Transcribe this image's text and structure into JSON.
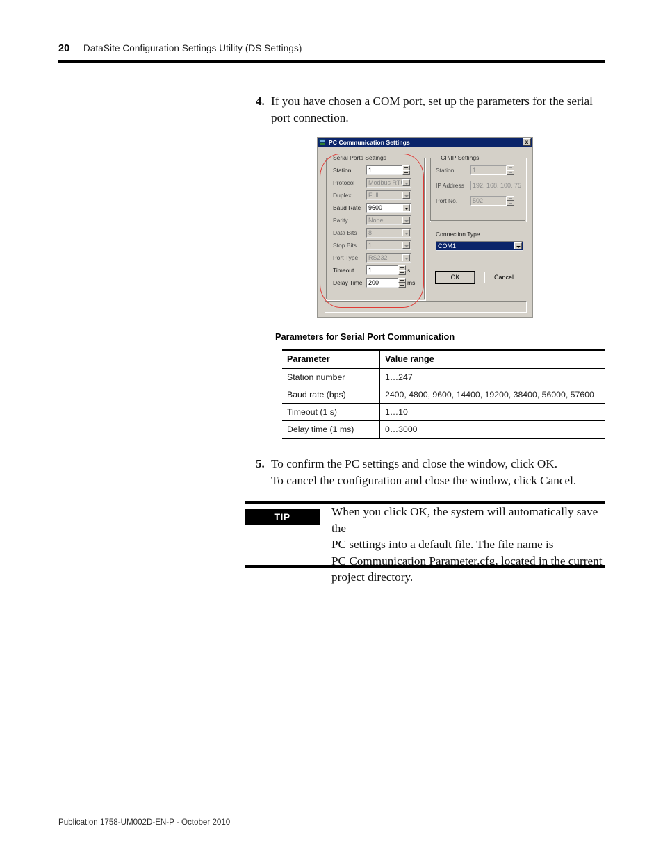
{
  "header": {
    "page_number": "20",
    "title": "DataSite Configuration Settings Utility (DS Settings)"
  },
  "steps": {
    "step4": {
      "number": "4.",
      "text": "If you have chosen a COM port, set up the parameters for the serial port connection."
    },
    "step5": {
      "number": "5.",
      "line1": "To confirm the PC settings and close the window, click OK.",
      "line2": "To cancel the configuration and close the window, click Cancel."
    }
  },
  "dialog": {
    "title": "PC Communication Settings",
    "close_label": "x",
    "serial_group_label": "Serial Ports Settings",
    "tcp_group_label": "TCP/IP Settings",
    "serial_fields": [
      {
        "label": "Station",
        "value": "1",
        "unit": ""
      },
      {
        "label": "Protocol",
        "value": "Modbus RTU",
        "unit": ""
      },
      {
        "label": "Duplex",
        "value": "Full",
        "unit": ""
      },
      {
        "label": "Baud Rate",
        "value": "9600",
        "unit": ""
      },
      {
        "label": "Parity",
        "value": "None",
        "unit": ""
      },
      {
        "label": "Data Bits",
        "value": "8",
        "unit": ""
      },
      {
        "label": "Stop Bits",
        "value": "1",
        "unit": ""
      },
      {
        "label": "Port Type",
        "value": "RS232",
        "unit": ""
      },
      {
        "label": "Timeout",
        "value": "1",
        "unit": "s"
      },
      {
        "label": "Delay Time",
        "value": "200",
        "unit": "ms"
      }
    ],
    "tcp_fields": [
      {
        "label": "Station",
        "value": "1"
      },
      {
        "label": "IP Address",
        "value": "192. 168. 100.  75"
      },
      {
        "label": "Port No.",
        "value": "502"
      }
    ],
    "connection_type_label": "Connection Type",
    "connection_type_value": "COM1",
    "ok_label": "OK",
    "cancel_label": "Cancel",
    "accent_selection_color": "#0a246a",
    "annotation_color": "#e03a36",
    "chrome_color": "#d4d0c8"
  },
  "table": {
    "caption": "Parameters for Serial Port Communication",
    "columns": [
      "Parameter",
      "Value range"
    ],
    "rows": [
      {
        "parameter": "Station number",
        "value_range": "1…247"
      },
      {
        "parameter": "Baud rate (bps)",
        "value_range": "2400, 4800, 9600, 14400, 19200, 38400, 56000, 57600"
      },
      {
        "parameter": "Timeout (1 s)",
        "value_range": "1…10"
      },
      {
        "parameter": "Delay time (1 ms)",
        "value_range": "0…3000"
      }
    ]
  },
  "tip": {
    "badge": "TIP",
    "line1": "When you click OK, the system will automatically save the",
    "line2": "PC settings into a default file. The file name is",
    "line3": "PC Communication Parameter.cfg, located in the current",
    "line4": "project directory."
  },
  "footer": {
    "text": "Publication 1758-UM002D-EN-P - October 2010"
  }
}
